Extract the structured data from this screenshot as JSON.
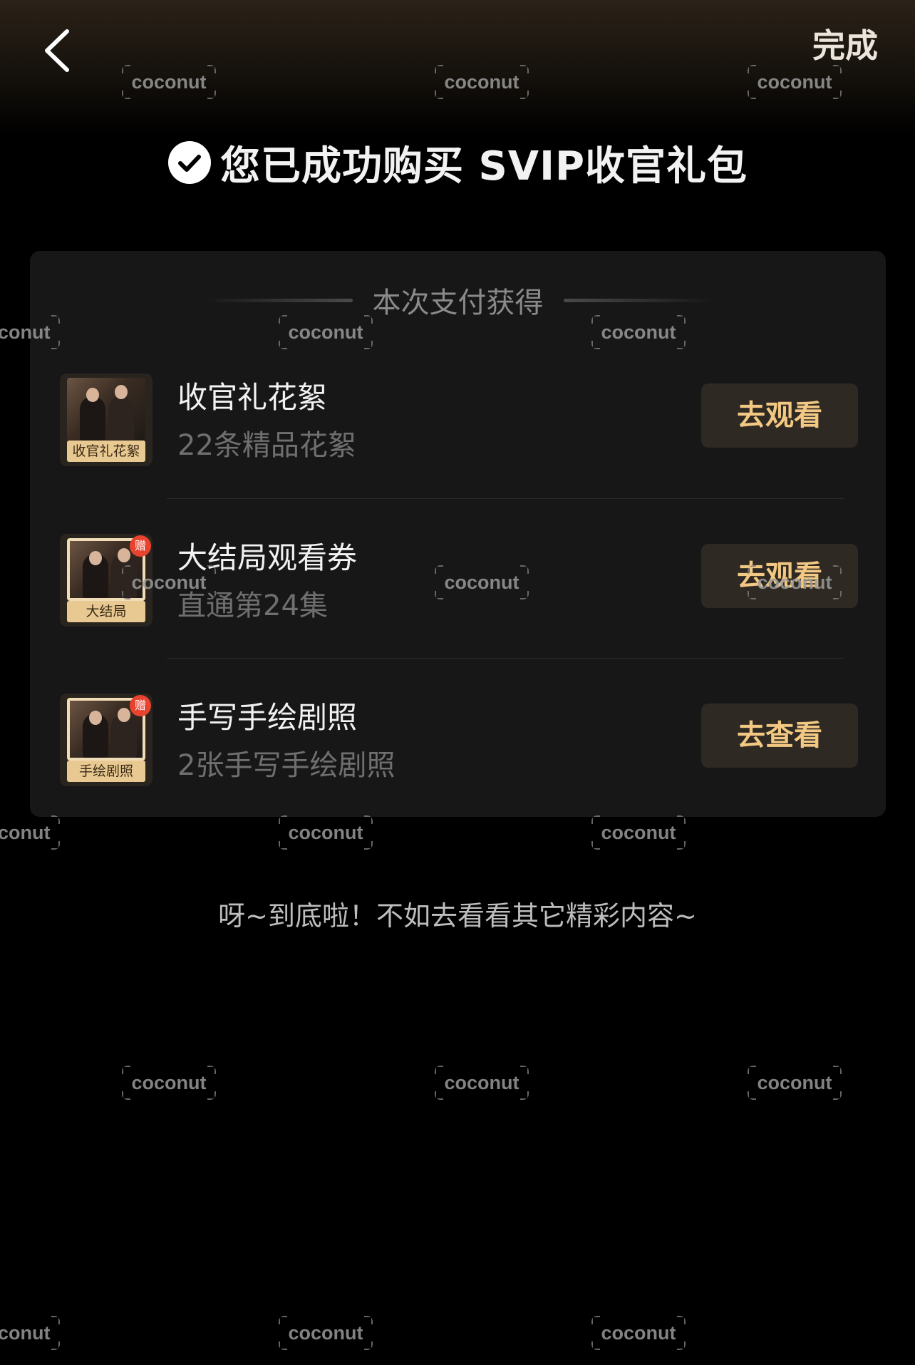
{
  "header": {
    "back_icon": "chevron-left-icon",
    "done_label": "完成"
  },
  "success": {
    "icon": "check-circle-icon",
    "message": "您已成功购买 SVIP收官礼包"
  },
  "card": {
    "title": "本次支付获得",
    "items": [
      {
        "thumb_tag": "收官礼花絮",
        "title": "收官礼花絮",
        "subtitle": "22条精品花絮",
        "button": "去观看",
        "gift_badge": ""
      },
      {
        "thumb_tag": "大结局",
        "title": "大结局观看券",
        "subtitle": "直通第24集",
        "button": "去观看",
        "gift_badge": "赠"
      },
      {
        "thumb_tag": "手绘剧照",
        "title": "手写手绘剧照",
        "subtitle": "2张手写手绘剧照",
        "button": "去查看",
        "gift_badge": "赠"
      }
    ]
  },
  "footer": {
    "message": "呀~到底啦！不如去看看其它精彩内容~"
  },
  "watermark": {
    "text": "coconut"
  },
  "colors": {
    "background": "#000000",
    "card": "#171717",
    "button_bg": "#2e2922",
    "button_text": "#f2c883",
    "gift_badge": "#e8432f"
  }
}
